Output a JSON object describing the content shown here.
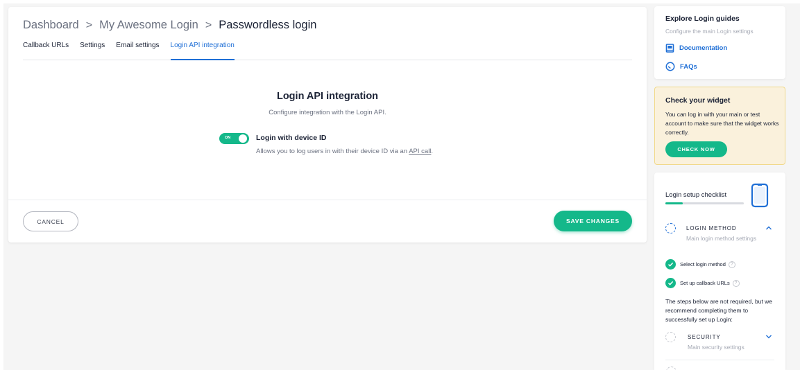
{
  "breadcrumb": {
    "items": [
      "Dashboard",
      "My Awesome Login",
      "Passwordless login"
    ],
    "separator": ">"
  },
  "tabs": [
    {
      "label": "Callback URLs",
      "active": false
    },
    {
      "label": "Settings",
      "active": false
    },
    {
      "label": "Email settings",
      "active": false
    },
    {
      "label": "Login API integration",
      "active": true
    }
  ],
  "section": {
    "title": "Login API integration",
    "subtitle": "Configure integration with the Login API."
  },
  "feature": {
    "toggle_label": "ON",
    "toggle_on": true,
    "title": "Login with device ID",
    "desc_before": "Allows you to log users in with their device ID via an ",
    "desc_link": "API call",
    "desc_after": "."
  },
  "footer": {
    "cancel_label": "CANCEL",
    "save_label": "SAVE CHANGES"
  },
  "guides": {
    "title": "Explore Login guides",
    "subtitle": "Configure the main Login settings",
    "documentation_label": "Documentation",
    "faqs_label": "FAQs"
  },
  "widget": {
    "title": "Check your widget",
    "text": "You can log in with your main or test account to make sure that the widget works correctly.",
    "button_label": "CHECK NOW"
  },
  "checklist": {
    "title": "Login setup checklist",
    "progress": 0.22,
    "login_method": {
      "heading": "LOGIN METHOD",
      "subtitle": "Main login method settings"
    },
    "tasks": [
      {
        "label": "Select login method",
        "done": true
      },
      {
        "label": "Set up callback URLs",
        "done": true
      }
    ],
    "recommend_text": "The steps below are not required, but we recommend completing them to successfully set up Login:",
    "security": {
      "heading": "SECURITY",
      "subtitle": "Main security settings"
    }
  },
  "colors": {
    "accent_green": "#14b88a",
    "link_blue": "#1f6fd6",
    "widget_bg": "#faf1dc"
  }
}
